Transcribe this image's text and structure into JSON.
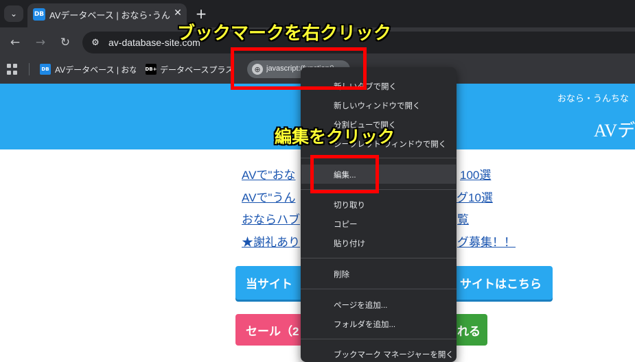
{
  "browser": {
    "tab_menu_icon": "⌄",
    "tab_favicon": "DB",
    "tab_title": "AVデータベース | おなら･うんちなど",
    "tab_close": "✕",
    "new_tab": "+",
    "back_icon": "←",
    "forward_icon": "→",
    "reload_icon": "↻",
    "site_info_icon": "⚙",
    "url": "av-database-site.com"
  },
  "bookmarks": {
    "items": [
      {
        "favicon": "DB",
        "label": "AVデータベース | おなら…"
      },
      {
        "favicon": "DB+",
        "label": "データベースプラス | ハ"
      },
      {
        "favicon": "⊕",
        "label": "javascript:(function()"
      }
    ]
  },
  "page": {
    "tagline": "おなら・うんちな",
    "logo": "AVデ",
    "links": [
      {
        "start": "AVで\"おな",
        "end": "100選"
      },
      {
        "start": "AVで\"うん",
        "end": "グ10選"
      },
      {
        "start": "おならハブ",
        "end": "覧"
      },
      {
        "start": "★謝礼あり",
        "end": "グ募集！！"
      }
    ],
    "button_blue": {
      "start": "当サイト",
      "end": "サイトはこちら"
    },
    "button_pink": {
      "start": "セール（2",
      "end": ""
    },
    "button_green": {
      "end": "れる"
    }
  },
  "context_menu": {
    "items": [
      "新しいタブで開く",
      "新しいウィンドウで開く",
      "分割ビューで開く",
      "シークレット ウィンドウで開く",
      "編集...",
      "切り取り",
      "コピー",
      "貼り付け",
      "削除",
      "ページを追加...",
      "フォルダを追加...",
      "ブックマーク マネージャーを開く"
    ]
  },
  "annotations": {
    "top": "ブックマークを右クリック",
    "middle": "編集をクリック"
  },
  "colors": {
    "header_blue": "#29a8f0",
    "link_blue": "#1a55b0",
    "annotation_yellow": "#ffff33",
    "annotation_red": "#ff0000"
  }
}
